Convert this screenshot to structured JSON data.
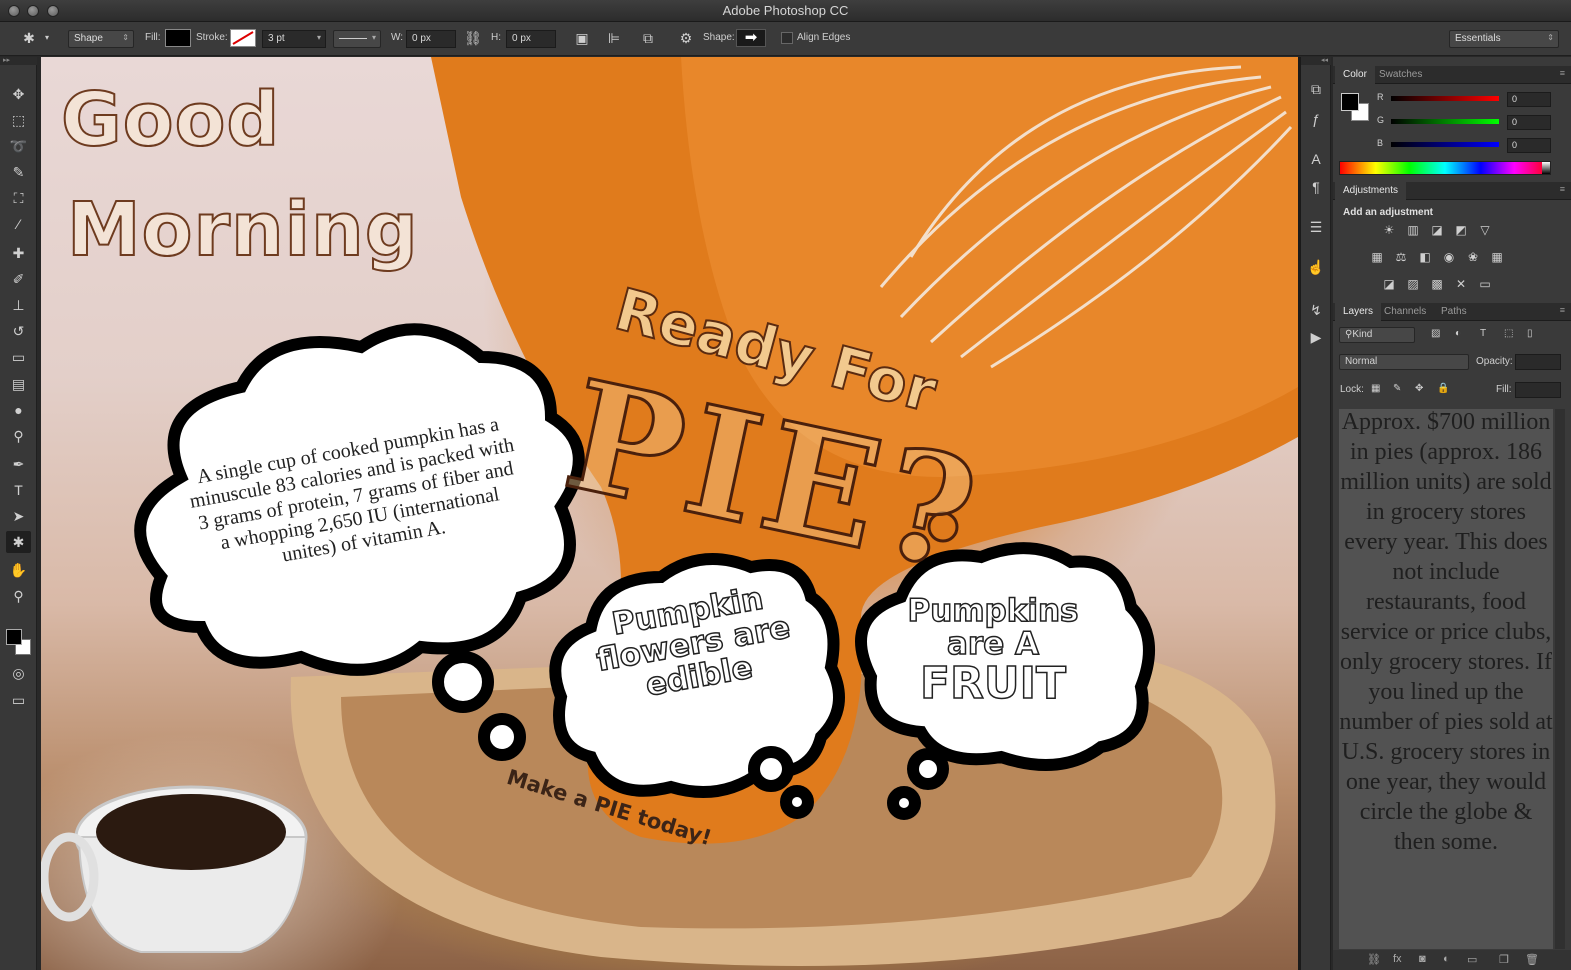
{
  "window": {
    "title": "Adobe Photoshop CC"
  },
  "options_bar": {
    "mode": "Shape",
    "fill_label": "Fill:",
    "stroke_label": "Stroke:",
    "stroke_width": "3 pt",
    "w_label": "W:",
    "w_value": "0 px",
    "h_label": "H:",
    "h_value": "0 px",
    "shape_label": "Shape:",
    "align_edges_label": "Align Edges",
    "align_edges_checked": false,
    "workspace": "Essentials"
  },
  "tools": [
    "move-tool",
    "marquee-tool",
    "lasso-tool",
    "quick-selection-tool",
    "crop-tool",
    "eyedropper-tool",
    "healing-brush-tool",
    "brush-tool",
    "clone-stamp-tool",
    "history-brush-tool",
    "eraser-tool",
    "gradient-tool",
    "blur-tool",
    "dodge-tool",
    "pen-tool",
    "type-tool",
    "path-selection-tool",
    "custom-shape-tool",
    "hand-tool",
    "zoom-tool",
    "quick-mask-tool",
    "screen-mode-tool"
  ],
  "active_tool": "custom-shape-tool",
  "canvas": {
    "good": "Good",
    "morning": "Morning",
    "ready_for": "Ready For",
    "pie": "PIE?",
    "fact": "A single cup of cooked pumpkin has a minuscule 83 calories and is packed with 3 grams of protein, 7 grams of fiber and a whopping 2,650 IU (international unites) of vitamin A.",
    "bubble1": "Pumpkin flowers are edible",
    "bubble2_line1": "Pumpkins",
    "bubble2_line2": "are A",
    "bubble2_line3": "FRUIT",
    "make_pie": "Make a PIE today!"
  },
  "color_panel": {
    "tabs": [
      "Color",
      "Swatches"
    ],
    "r_label": "R",
    "r_value": "0",
    "g_label": "G",
    "g_value": "0",
    "b_label": "B",
    "b_value": "0"
  },
  "adjustments_panel": {
    "tab": "Adjustments",
    "title": "Add an adjustment"
  },
  "layers_panel": {
    "tabs": [
      "Layers",
      "Channels",
      "Paths"
    ],
    "filter": "Kind",
    "blend_mode": "Normal",
    "opacity_label": "Opacity:",
    "lock_label": "Lock:",
    "fill_label": "Fill:",
    "content_text": "Approx. $700 million in pies (approx. 186 million units) are sold in grocery stores every year. This does not include restaurants, food service or price clubs, only grocery stores. If you lined up the number of pies sold at U.S. grocery stores in one year, they would circle the globe & then some."
  },
  "colors": {
    "ui_dark": "#282828",
    "panel": "#3a3a3a",
    "pumpkin": "#d97516",
    "crust": "#c79d63",
    "headline_stroke": "#6e3b1f"
  }
}
